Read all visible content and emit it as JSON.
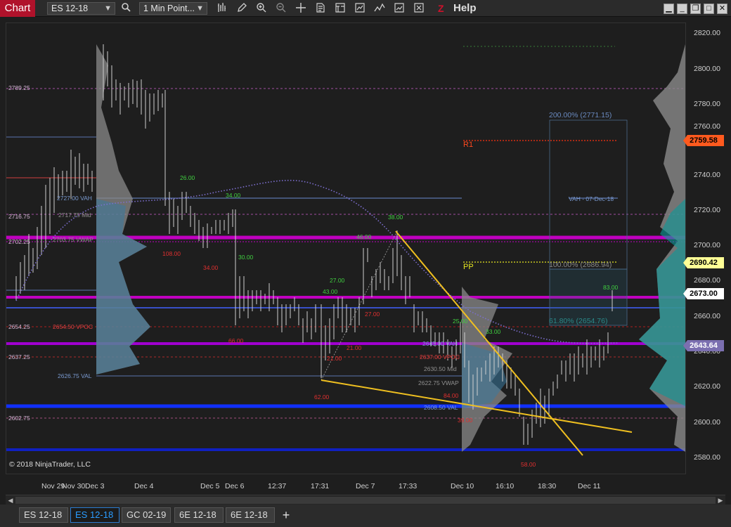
{
  "toolbar": {
    "chart_label": "Chart",
    "instrument": "ES 12-18",
    "interval": "1 Min Point...",
    "help_label": "Help",
    "tools": [
      "search-icon",
      "bar-type-icon",
      "drawing-pencil-icon",
      "zoom-in-icon",
      "zoom-out-icon",
      "crosshair-icon",
      "properties-icon",
      "data-box-icon",
      "indicators-icon",
      "strategies-icon",
      "templates-icon",
      "chart-trader-icon"
    ]
  },
  "window_buttons": [
    "minimize-icon",
    "restore-icon",
    "maximize-icon",
    "close-icon"
  ],
  "price_axis": {
    "ticks": [
      "2820.00",
      "2800.00",
      "2780.00",
      "2760.00",
      "2740.00",
      "2720.00",
      "2700.00",
      "2680.00",
      "2660.00",
      "2640.00",
      "2620.00",
      "2600.00",
      "2580.00"
    ],
    "tags": [
      {
        "value": "2759.58",
        "bg": "#ff5a1e",
        "fg": "#000000"
      },
      {
        "value": "2690.42",
        "bg": "#ffff96",
        "fg": "#000000"
      },
      {
        "value": "2673.00",
        "bg": "#ffffff",
        "fg": "#000000"
      },
      {
        "value": "2643.64",
        "bg": "#7b6fb0",
        "fg": "#ffffff"
      }
    ]
  },
  "time_axis": [
    "Nov 29",
    "Nov 30",
    "Dec 3",
    "Dec 4",
    "Dec 5",
    "Dec 6",
    "12:37",
    "17:31",
    "Dec 7",
    "17:33",
    "Dec 10",
    "16:10",
    "18:30",
    "Dec 11"
  ],
  "levels": {
    "left": [
      "2789.25",
      "2716.75",
      "2702.25",
      "2654.25",
      "2637.25",
      "2626.75 VAL",
      "2602.75"
    ],
    "vp_labels": [
      "2727.00 VAH",
      "2717.75 Mid",
      "2703.75 VWAP",
      "2654.50 VPOC",
      "2645.00 VAH",
      "2637.00 VPOC",
      "2630.50 Mid",
      "2622.75 VWAP",
      "2608.50 VAL"
    ],
    "vah_note": "VAH - 07-Dec-18"
  },
  "pivots": {
    "r1": "R1",
    "pp": "PP"
  },
  "fib": {
    "f200": "200.00% (2771.15)",
    "f100": "100.00% (2686.94)",
    "f61": "61.80% (2654.76)"
  },
  "swing_labels_green": [
    "26.00",
    "34.00",
    "30.00",
    "27.00",
    "43.00",
    "46.00",
    "38.00",
    "25.00",
    "33.00",
    "83.00"
  ],
  "swing_labels_red": [
    "108.00",
    "34.00",
    "66.00",
    "27.00",
    "21.00",
    "21.00",
    "62.00",
    "84.00",
    "39.00",
    "58.00"
  ],
  "copyright": "© 2018 NinjaTrader, LLC",
  "tabs": [
    "ES 12-18",
    "ES 12-18",
    "GC 02-19",
    "6E 12-18",
    "6E 12-18"
  ],
  "active_tab": 1,
  "add_tab_label": "+"
}
